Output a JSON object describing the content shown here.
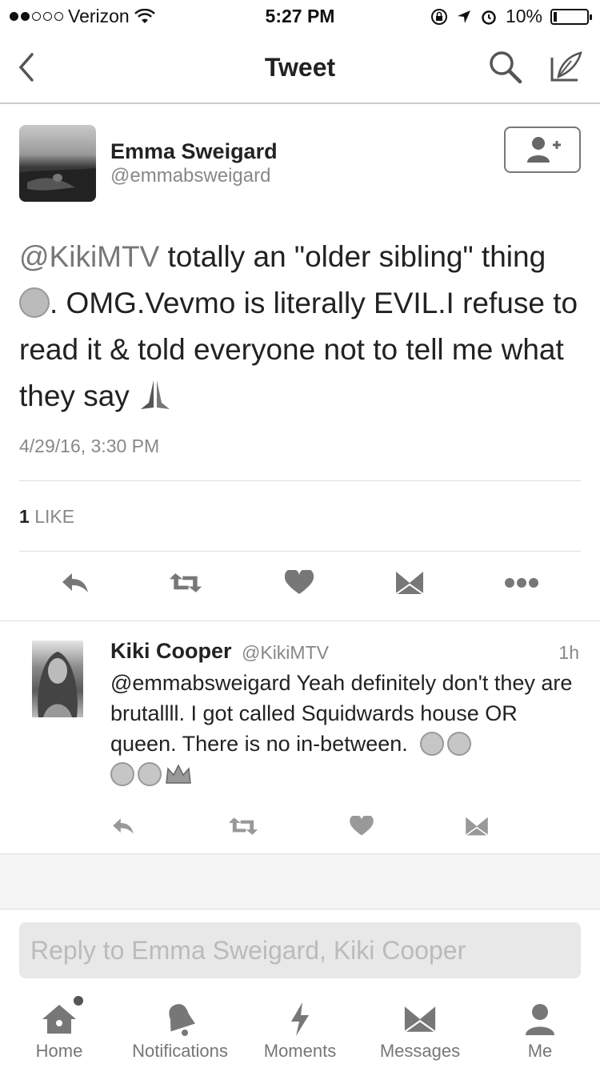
{
  "status_bar": {
    "carrier": "Verizon",
    "time": "5:27 PM",
    "battery": "10%",
    "battery_level": 0.1
  },
  "nav": {
    "title": "Tweet"
  },
  "tweet": {
    "author_name": "Emma Sweigard",
    "author_handle": "@emmabsweigard",
    "mention": "@KikiMTV",
    "text_part1": " totally an \"older sibling\" thing ",
    "text_part2": ". OMG.Vevmo is literally EVIL.I refuse to read it & told everyone not to tell me what they say ",
    "timestamp": "4/29/16, 3:30 PM",
    "like_count": "1",
    "like_label": "LIKE"
  },
  "reply": {
    "name": "Kiki Cooper",
    "handle": "@KikiMTV",
    "time": "1h",
    "text": "@emmabsweigard Yeah definitely don't they are brutallll. I got called Squidwards house OR queen. There is no in-between."
  },
  "reply_input": {
    "placeholder": "Reply to Emma Sweigard, Kiki Cooper"
  },
  "tabs": [
    {
      "label": "Home",
      "icon": "home-icon"
    },
    {
      "label": "Notifications",
      "icon": "bell-icon"
    },
    {
      "label": "Moments",
      "icon": "lightning-icon"
    },
    {
      "label": "Messages",
      "icon": "envelope-icon"
    },
    {
      "label": "Me",
      "icon": "person-icon"
    }
  ]
}
